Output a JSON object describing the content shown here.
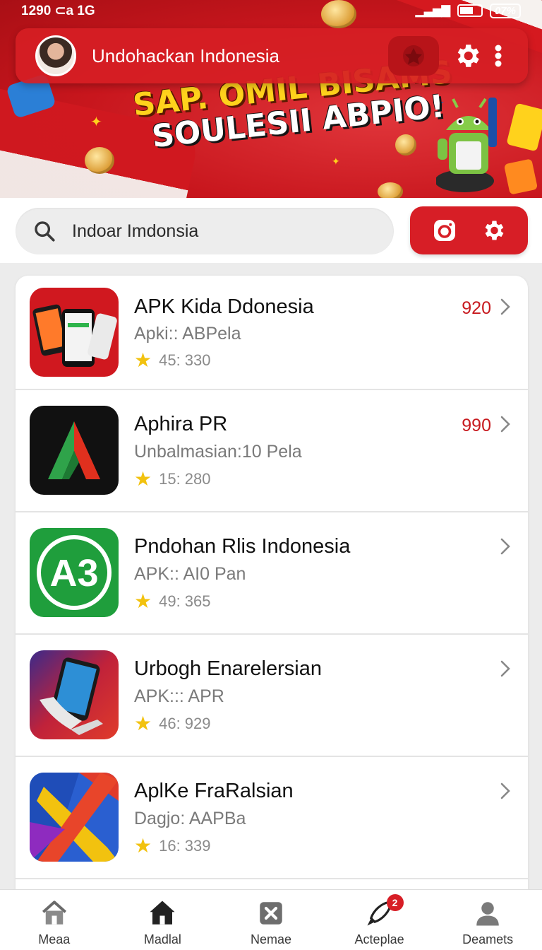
{
  "status_bar": {
    "time": "1290 ⊂a 1G",
    "battery_text": "07%"
  },
  "header": {
    "title": "Undohackan Indonesia",
    "icons": [
      "avatar",
      "emblem-icon",
      "gear-icon",
      "kebab-menu-icon"
    ]
  },
  "banner": {
    "line1": "SAP. OMIL BISAMS",
    "line2": "SOULESII ABPIO!"
  },
  "search": {
    "value": "Indoar Imdonsia",
    "placeholder": "Indoar Imdonsia"
  },
  "apps": [
    {
      "name": "APK Kida Ddonesia",
      "subtitle": "Apki:: ABPela",
      "rating": "45: 330",
      "price": "920",
      "icon": "phones-red-icon"
    },
    {
      "name": "Aphira PR",
      "subtitle": "Unbalmasian:10 Pela",
      "rating": "15: 280",
      "price": "990",
      "icon": "arrow-logo-icon"
    },
    {
      "name": "Pndohan Rlis Indonesia",
      "subtitle": "APK:: AI0 Pan",
      "rating": "49: 365",
      "price": "",
      "icon": "a3-logo-icon"
    },
    {
      "name": "Urbogh Enarelersian",
      "subtitle": "APK::: APR",
      "rating": "46: 929",
      "price": "",
      "icon": "phone-hand-icon"
    },
    {
      "name": "AplKe FraRalsian",
      "subtitle": "Dagjo: AAPBa",
      "rating": "16: 339",
      "price": "",
      "icon": "colorful-x-icon"
    }
  ],
  "bottom_nav": [
    {
      "label": "Meaa",
      "icon": "home-outline-icon"
    },
    {
      "label": "Madlal",
      "icon": "home-filled-icon"
    },
    {
      "label": "Nemae",
      "icon": "box-x-icon"
    },
    {
      "label": "Acteplae",
      "icon": "rocket-icon",
      "badge": "2"
    },
    {
      "label": "Deamets",
      "icon": "person-icon"
    }
  ],
  "colors": {
    "brand_red": "#d71e26",
    "price_red": "#c71a1f",
    "star_yellow": "#f2c20f"
  }
}
